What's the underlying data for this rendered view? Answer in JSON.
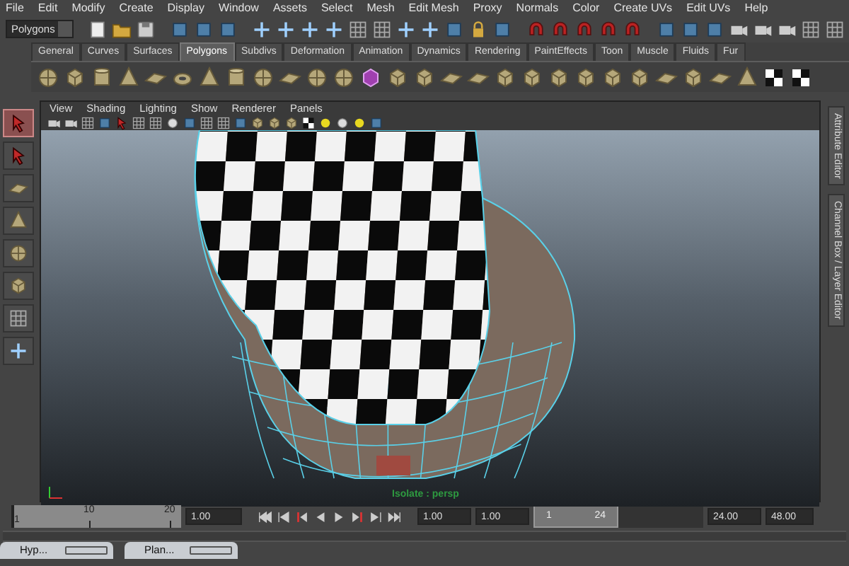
{
  "menu_bar": [
    "File",
    "Edit",
    "Modify",
    "Create",
    "Display",
    "Window",
    "Assets",
    "Select",
    "Mesh",
    "Edit Mesh",
    "Proxy",
    "Normals",
    "Color",
    "Create UVs",
    "Edit UVs",
    "Help"
  ],
  "status_line": {
    "menu_set": "Polygons"
  },
  "shelf_tabs": [
    {
      "label": "General",
      "selected": false
    },
    {
      "label": "Curves",
      "selected": false
    },
    {
      "label": "Surfaces",
      "selected": false
    },
    {
      "label": "Polygons",
      "selected": true
    },
    {
      "label": "Subdivs",
      "selected": false
    },
    {
      "label": "Deformation",
      "selected": false
    },
    {
      "label": "Animation",
      "selected": false
    },
    {
      "label": "Dynamics",
      "selected": false
    },
    {
      "label": "Rendering",
      "selected": false
    },
    {
      "label": "PaintEffects",
      "selected": false
    },
    {
      "label": "Toon",
      "selected": false
    },
    {
      "label": "Muscle",
      "selected": false
    },
    {
      "label": "Fluids",
      "selected": false
    },
    {
      "label": "Fur",
      "selected": false
    }
  ],
  "toolbox": [
    {
      "selected": true
    },
    {
      "selected": false
    },
    {
      "selected": false
    },
    {
      "selected": false
    },
    {
      "selected": false
    },
    {
      "selected": false
    },
    {
      "selected": false
    },
    {
      "selected": false
    }
  ],
  "viewport": {
    "menu": [
      "View",
      "Shading",
      "Lighting",
      "Show",
      "Renderer",
      "Panels"
    ],
    "status_text": "Isolate : persp"
  },
  "side_tabs": [
    "Attribute Editor",
    "Channel Box / Layer Editor"
  ],
  "time_slider": {
    "ticks": [
      "1",
      "10",
      "20"
    ],
    "current_frame": "1.00",
    "level": 0
  },
  "range": {
    "start": "1.00",
    "playback_start": "1.00",
    "slider_start": "1",
    "slider_end": "24",
    "level": 0.5,
    "playback_end": "24.00",
    "end": "48.00"
  },
  "taskbar": [
    "Hyp...",
    "Plan..."
  ]
}
